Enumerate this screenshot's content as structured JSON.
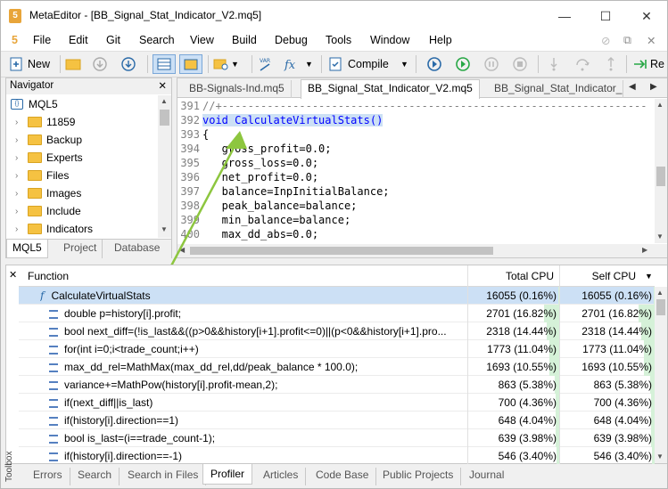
{
  "window": {
    "app_icon": "5",
    "title": "MetaEditor - [BB_Signal_Stat_Indicator_V2.mq5]",
    "controls": {
      "minimize": "—",
      "maximize": "☐",
      "close": "✕"
    },
    "mdi_controls": {
      "help": "⊘",
      "restore": "⧉",
      "close": "✕"
    }
  },
  "menu": {
    "app_icon": "5",
    "items": [
      "File",
      "Edit",
      "Git",
      "Search",
      "View",
      "Build",
      "Debug",
      "Tools",
      "Window",
      "Help"
    ]
  },
  "toolbar": {
    "new_label": "New",
    "compile_label": "Compile",
    "re_label": "Re"
  },
  "navigator": {
    "title": "Navigator",
    "root": "MQL5",
    "items": [
      "11859",
      "Backup",
      "Experts",
      "Files",
      "Images",
      "Include",
      "Indicators"
    ],
    "tabs": [
      "MQL5",
      "Project",
      "Database"
    ]
  },
  "editor": {
    "tabs": [
      "BB-Signals-Ind.mq5",
      "BB_Signal_Stat_Indicator_V2.mq5",
      "BB_Signal_Stat_Indicator_D"
    ],
    "lines": [
      {
        "n": "391",
        "text": "//+------------------------------------------------------------------"
      },
      {
        "n": "392",
        "text": "void CalculateVirtualStats()"
      },
      {
        "n": "393",
        "text": "{"
      },
      {
        "n": "394",
        "text": "   gross_profit=0.0;"
      },
      {
        "n": "395",
        "text": "   gross_loss=0.0;"
      },
      {
        "n": "396",
        "text": "   net_profit=0.0;"
      },
      {
        "n": "397",
        "text": "   balance=InpInitialBalance;"
      },
      {
        "n": "398",
        "text": "   peak_balance=balance;"
      },
      {
        "n": "399",
        "text": "   min_balance=balance;"
      },
      {
        "n": "400",
        "text": "   max_dd_abs=0.0;"
      }
    ]
  },
  "profiler": {
    "col_function": "Function",
    "col_total": "Total CPU",
    "col_self": "Self CPU",
    "rows": [
      {
        "func": "CalculateVirtualStats",
        "total": "16055",
        "total_pct": "(0.16%)",
        "self": "16055",
        "self_pct": "(0.16%)",
        "bar": 0.0016
      },
      {
        "func": "double p=history[i].profit;",
        "total": "2701",
        "total_pct": "(16.82%)",
        "self": "2701",
        "self_pct": "(16.82%)",
        "bar": 0.1682
      },
      {
        "func": "bool next_diff=(!is_last&&((p>0&&history[i+1].profit<=0)||(p<0&&history[i+1].pro...",
        "total": "2318",
        "total_pct": "(14.44%)",
        "self": "2318",
        "self_pct": "(14.44%)",
        "bar": 0.1444
      },
      {
        "func": "for(int i=0;i<trade_count;i++)",
        "total": "1773",
        "total_pct": "(11.04%)",
        "self": "1773",
        "self_pct": "(11.04%)",
        "bar": 0.1104
      },
      {
        "func": "max_dd_rel=MathMax(max_dd_rel,dd/peak_balance * 100.0);",
        "total": "1693",
        "total_pct": "(10.55%)",
        "self": "1693",
        "self_pct": "(10.55%)",
        "bar": 0.1055
      },
      {
        "func": "variance+=MathPow(history[i].profit-mean,2);",
        "total": "863",
        "total_pct": "(5.38%)",
        "self": "863",
        "self_pct": "(5.38%)",
        "bar": 0.0538
      },
      {
        "func": "if(next_diff||is_last)",
        "total": "700",
        "total_pct": "(4.36%)",
        "self": "700",
        "self_pct": "(4.36%)",
        "bar": 0.0436
      },
      {
        "func": "if(history[i].direction==1)",
        "total": "648",
        "total_pct": "(4.04%)",
        "self": "648",
        "self_pct": "(4.04%)",
        "bar": 0.0404
      },
      {
        "func": "bool is_last=(i==trade_count-1);",
        "total": "639",
        "total_pct": "(3.98%)",
        "self": "639",
        "self_pct": "(3.98%)",
        "bar": 0.0398
      },
      {
        "func": "if(history[i].direction==-1)",
        "total": "546",
        "total_pct": "(3.40%)",
        "self": "546",
        "self_pct": "(3.40%)",
        "bar": 0.034
      }
    ],
    "toolbox_label": "Toolbox",
    "tabs": [
      "Errors",
      "Search",
      "Search in Files",
      "Profiler",
      "Articles",
      "Code Base",
      "Public Projects",
      "Journal"
    ]
  },
  "colors": {
    "accent_green": "#8dc63f",
    "selection": "#cce0f5",
    "bar": "#d5f1d8"
  }
}
